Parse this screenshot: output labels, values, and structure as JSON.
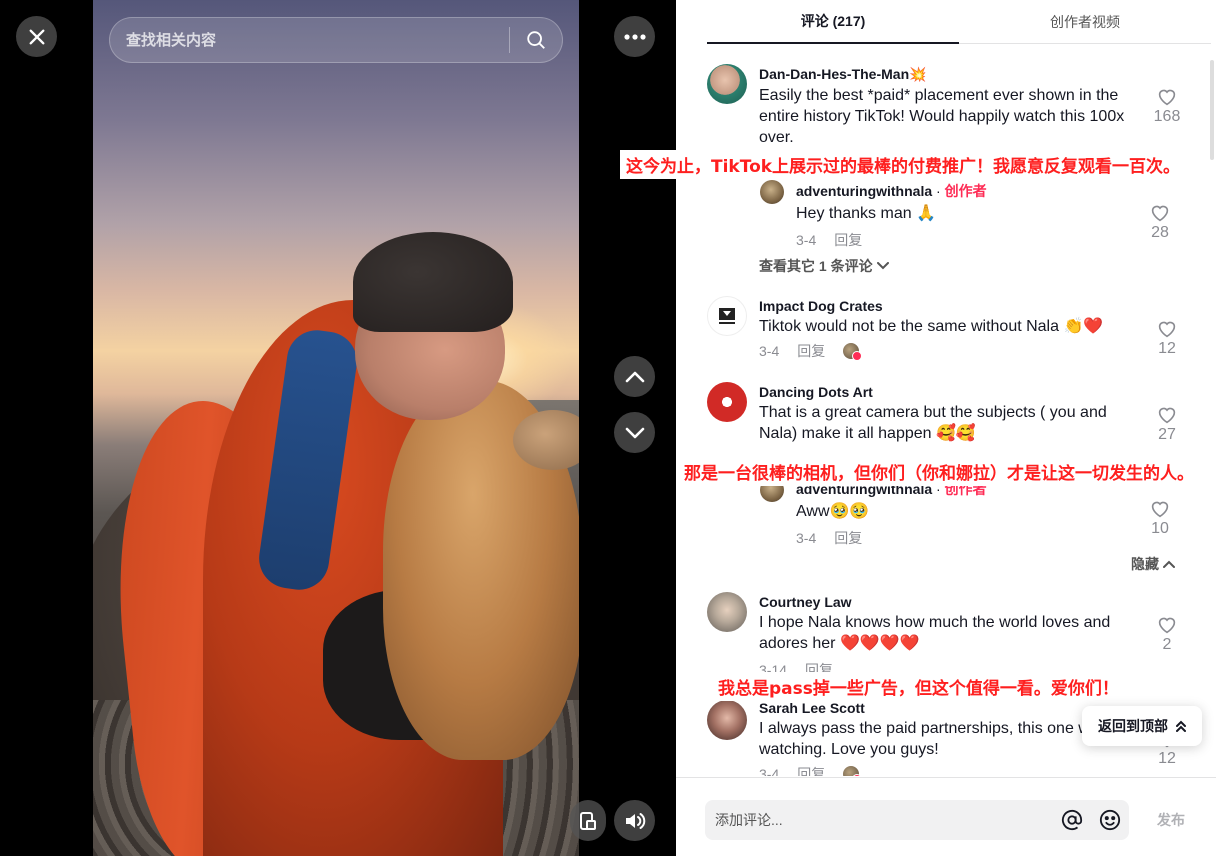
{
  "search": {
    "placeholder": "查找相关内容"
  },
  "video_controls": {
    "close_icon": "close-icon",
    "more_icon": "more-dots-icon",
    "up_icon": "chevron-up-icon",
    "down_icon": "chevron-down-icon",
    "volume_icon": "volume-icon",
    "mini_icon": "mini-player-icon"
  },
  "tabs": [
    {
      "label": "评论 (217)",
      "active": true
    },
    {
      "label": "创作者视频",
      "active": false
    }
  ],
  "comments": [
    {
      "user": "Dan-Dan-Hes-The-Man💥",
      "text": "Easily the best *paid* placement ever shown in the entire history TikTok! Would happily watch this 100x over.",
      "likes": "168"
    },
    {
      "user": "adventuringwithnala",
      "creator_label": "创作者",
      "text": "Hey thanks man 🙏",
      "date": "3-4",
      "reply": "回复",
      "likes": "28"
    },
    {
      "user": "Impact Dog Crates",
      "text": "Tiktok would not be the same without Nala 👏❤️",
      "date": "3-4",
      "reply": "回复",
      "likes": "12"
    },
    {
      "user": "Dancing Dots Art",
      "text": "That is a great camera but the subjects ( you and Nala) make it all happen 🥰🥰",
      "likes": "27"
    },
    {
      "user": "adventuringwithnala",
      "creator_label": "创作者",
      "text": "Aww🥹🥹",
      "date": "3-4",
      "reply": "回复",
      "likes": "10"
    },
    {
      "user": "Courtney Law",
      "text": "I hope Nala knows how much the world loves and adores her ❤️❤️❤️❤️",
      "date": "3-14",
      "reply": "回复",
      "likes": "2"
    },
    {
      "user": "Sarah Lee Scott",
      "text": "I always pass the paid partnerships, this one worth watching. Love you guys!",
      "date": "3-4",
      "reply": "回复",
      "likes": "12"
    }
  ],
  "view_more_replies": "查看其它 1 条评论",
  "hide_label": "隐藏",
  "overlays": [
    "这今为止，TikTok上展示过的最棒的付费推广！我愿意反复观看一百次。",
    "那是一台很棒的相机，但你们（你和娜拉）才是让这一切发生的人。",
    "我总是pass掉一些广告，但这个值得一看。爱你们！"
  ],
  "back_to_top": "返回到顶部",
  "comment_input": {
    "placeholder": "添加评论..."
  },
  "post_label": "发布",
  "colors": {
    "accent": "#fe2c55",
    "overlay_text": "#fe1f1f"
  }
}
